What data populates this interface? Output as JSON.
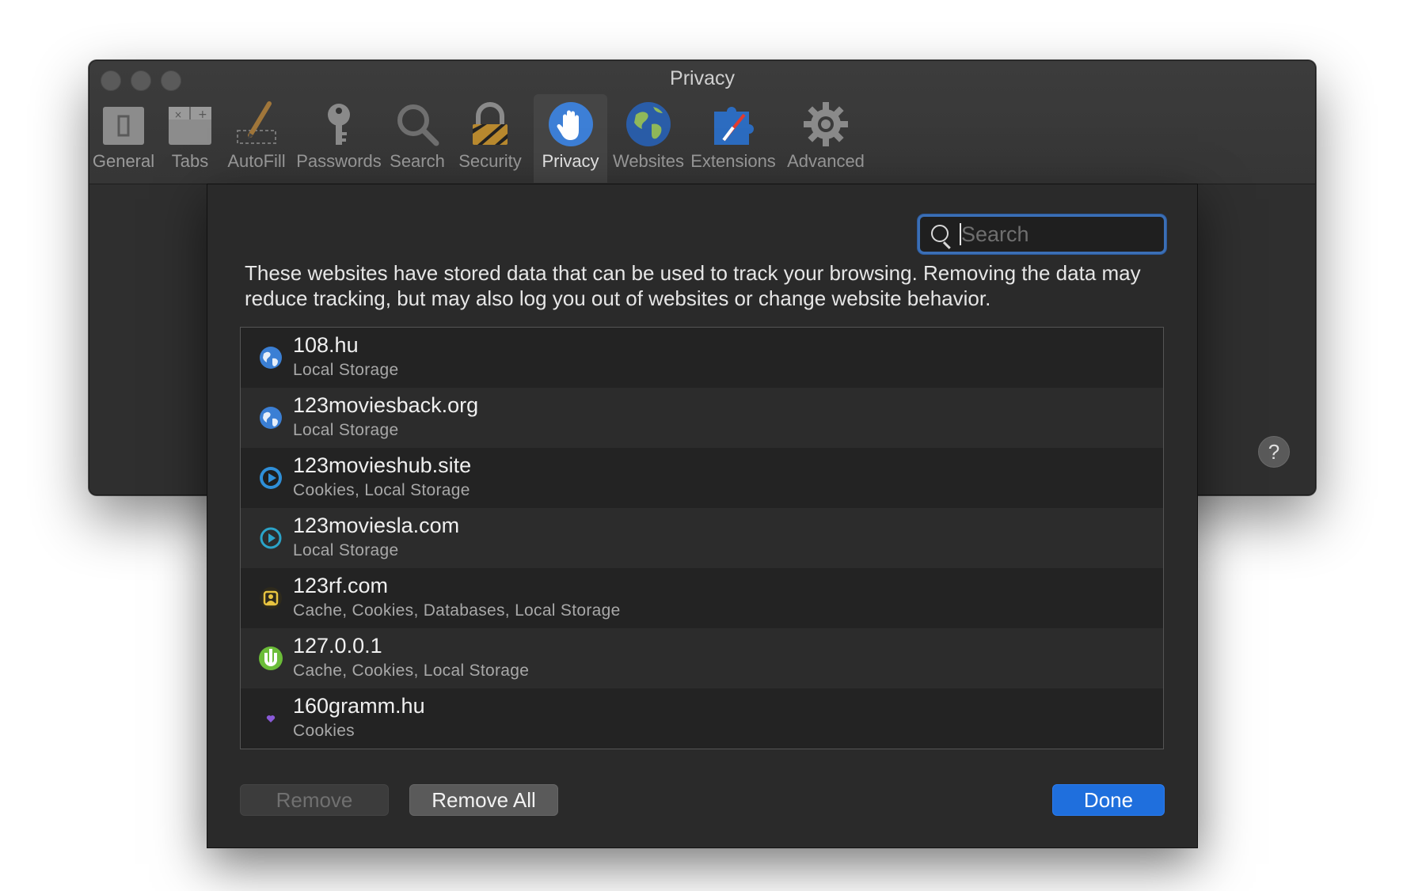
{
  "window": {
    "title": "Privacy",
    "toolbar": [
      {
        "label": "General",
        "icon": "general-icon"
      },
      {
        "label": "Tabs",
        "icon": "tabs-icon"
      },
      {
        "label": "AutoFill",
        "icon": "autofill-icon"
      },
      {
        "label": "Passwords",
        "icon": "key-icon"
      },
      {
        "label": "Search",
        "icon": "search-icon"
      },
      {
        "label": "Security",
        "icon": "lock-icon"
      },
      {
        "label": "Privacy",
        "icon": "hand-icon",
        "selected": true
      },
      {
        "label": "Websites",
        "icon": "globe-icon"
      },
      {
        "label": "Extensions",
        "icon": "extensions-icon"
      },
      {
        "label": "Advanced",
        "icon": "gear-icon"
      }
    ],
    "help": "?"
  },
  "sheet": {
    "search_placeholder": "Search",
    "description": "These websites have stored data that can be used to track your browsing. Removing the data may reduce tracking, but may also log you out of websites or change website behavior.",
    "websites": [
      {
        "name": "108.hu",
        "data": "Local Storage",
        "icon": "globe-icon"
      },
      {
        "name": "123moviesback.org",
        "data": "Local Storage",
        "icon": "globe-icon"
      },
      {
        "name": "123movieshub.site",
        "data": "Cookies, Local Storage",
        "icon": "play-icon"
      },
      {
        "name": "123moviesla.com",
        "data": "Local Storage",
        "icon": "play-outline-icon"
      },
      {
        "name": "123rf.com",
        "data": "Cache, Cookies, Databases, Local Storage",
        "icon": "123rf-icon"
      },
      {
        "name": "127.0.0.1",
        "data": "Cache, Cookies, Local Storage",
        "icon": "utorrent-icon"
      },
      {
        "name": "160gramm.hu",
        "data": "Cookies",
        "icon": "heart-icon"
      }
    ],
    "buttons": {
      "remove": "Remove",
      "remove_all": "Remove All",
      "done": "Done"
    }
  },
  "colors": {
    "accent": "#1f6fdd",
    "focus_ring": "#3b6fb6"
  }
}
